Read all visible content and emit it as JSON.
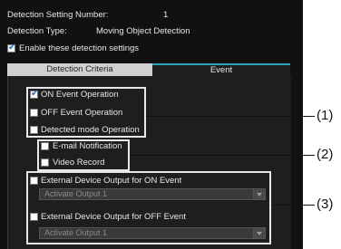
{
  "header": {
    "setting_number_label": "Detection Setting Number:",
    "setting_number_value": "1",
    "type_label": "Detection Type:",
    "type_value": "Moving Object Detection",
    "enable_label": "Enable these detection settings",
    "enable_checked": true
  },
  "tabs": [
    {
      "label": "Detection Criteria",
      "active": false
    },
    {
      "label": "Event",
      "active": true
    }
  ],
  "group1": [
    {
      "label": "ON Event Operation",
      "checked": true
    },
    {
      "label": "OFF Event Operation",
      "checked": false
    },
    {
      "label": "Detected mode Operation",
      "checked": false
    }
  ],
  "group2": [
    {
      "label": "E-mail Notification",
      "checked": false
    },
    {
      "label": "Video Record",
      "checked": false
    }
  ],
  "group3": {
    "on_label": "External Device Output for ON Event",
    "on_checked": false,
    "on_select": "Activate Output 1",
    "off_label": "External Device Output for OFF Event",
    "off_checked": false,
    "off_select": "Activate Output 1"
  },
  "callouts": [
    "(1)",
    "(2)",
    "(3)"
  ]
}
